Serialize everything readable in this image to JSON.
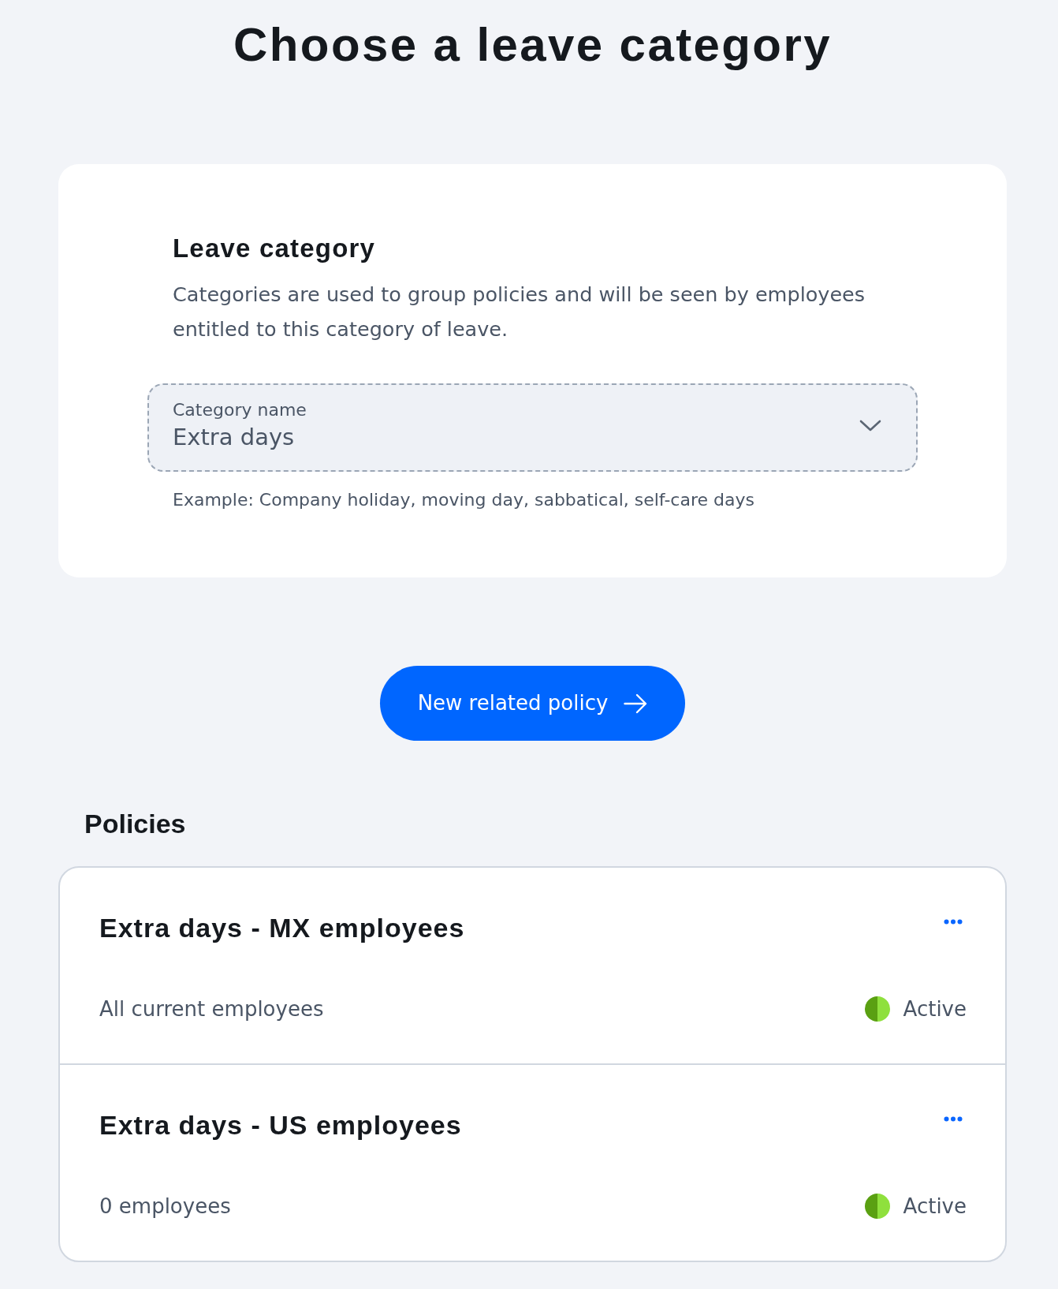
{
  "page": {
    "title": "Choose a leave category"
  },
  "category_card": {
    "heading": "Leave category",
    "description": "Categories are used to group policies and will be seen by employees entitled to this category of leave.",
    "field": {
      "label": "Category name",
      "value": "Extra days"
    },
    "hint": "Example: Company holiday, moving day, sabbatical, self-care days"
  },
  "new_policy_button": {
    "label": "New related policy"
  },
  "policies": {
    "heading": "Policies",
    "items": [
      {
        "name": "Extra days - MX employees",
        "eligibility": "All current employees",
        "status": "Active"
      },
      {
        "name": "Extra days - US employees",
        "eligibility": "0 employees",
        "status": "Active"
      }
    ]
  }
}
